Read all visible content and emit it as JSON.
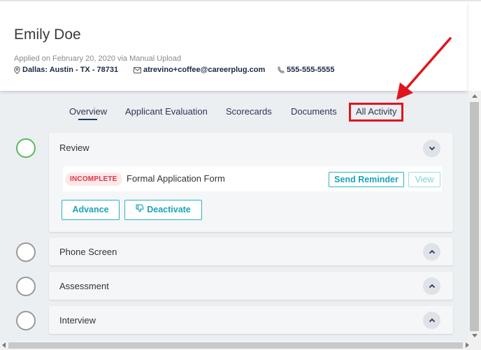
{
  "applicant": {
    "name": "Emily Doe",
    "applied": "Applied on February 20, 2020 via Manual Upload",
    "location": "Dallas: Austin - TX - 78731",
    "email": "atrevino+coffee@careerplug.com",
    "phone": "555-555-5555"
  },
  "tabs": [
    "Overview",
    "Applicant Evaluation",
    "Scorecards",
    "Documents",
    "All Activity"
  ],
  "active_tab": "Overview",
  "highlighted_tab": "All Activity",
  "stages": [
    {
      "title": "Review",
      "status": "complete",
      "expanded": true,
      "task": {
        "badge": "INCOMPLETE",
        "name": "Formal Application Form",
        "send_reminder_label": "Send Reminder",
        "view_label": "View"
      },
      "advance_label": "Advance",
      "deactivate_label": "Deactivate"
    },
    {
      "title": "Phone Screen",
      "status": "pending",
      "expanded": false
    },
    {
      "title": "Assessment",
      "status": "pending",
      "expanded": false
    },
    {
      "title": "Interview",
      "status": "pending",
      "expanded": false
    }
  ],
  "colors": {
    "accent": "#1aa4b7",
    "annotation_red": "#e0151c",
    "complete_green": "#5cb85c",
    "badge_red": "#e03445",
    "tab_text": "#2a3550"
  },
  "icons": [
    "map-pin-icon",
    "mail-icon",
    "phone-icon",
    "chevron-down-icon",
    "chevron-up-icon",
    "thumbs-down-icon"
  ]
}
